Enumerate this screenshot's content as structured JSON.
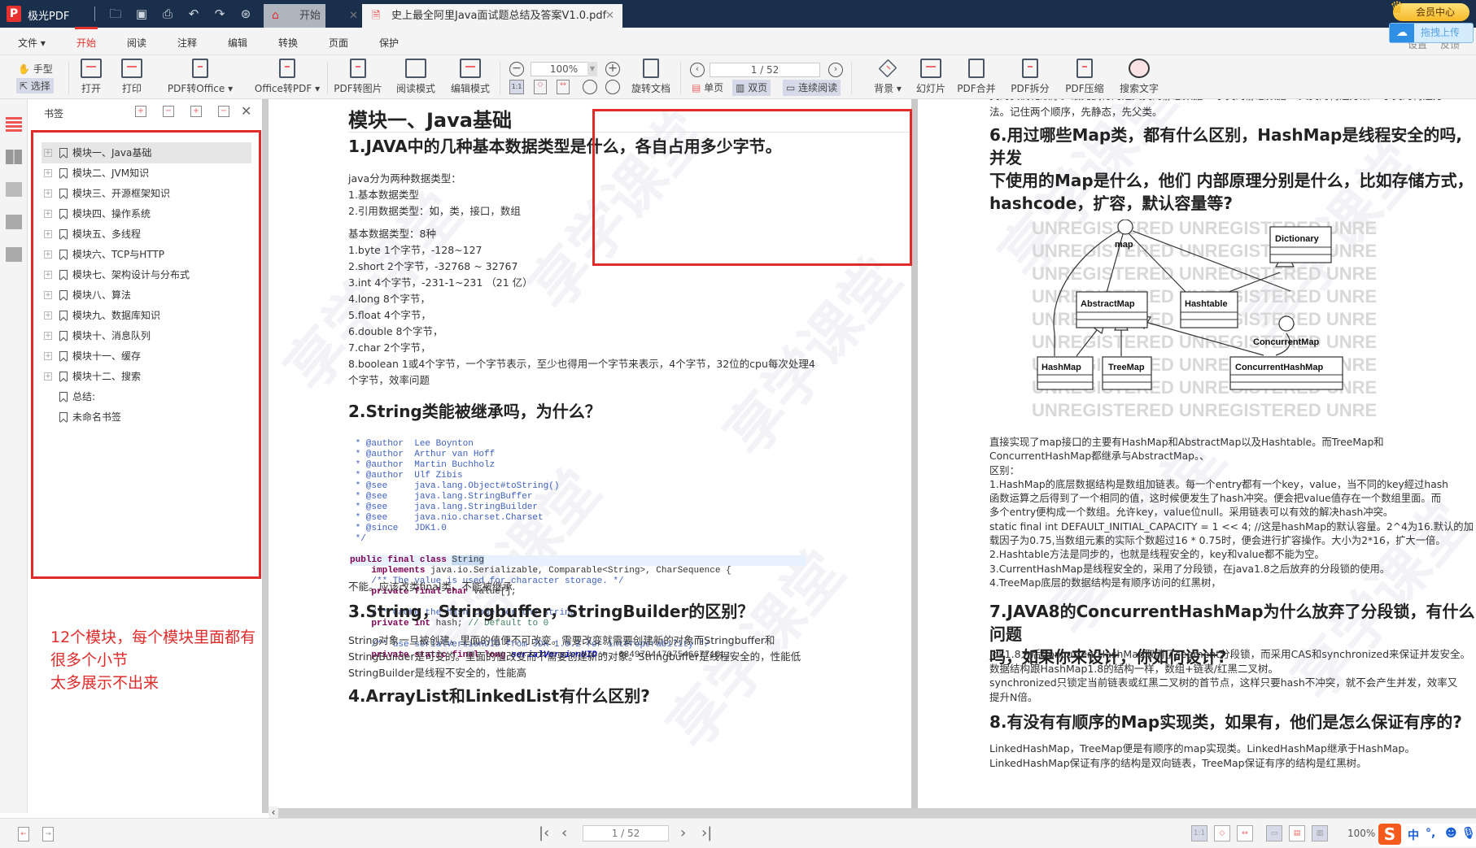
{
  "app": {
    "name": "极光PDF",
    "logo": "P"
  },
  "tabs": [
    {
      "label": "开始",
      "icon": "home-icon",
      "active": false
    },
    {
      "label": "史上最全阿里Java面试题总结及答案V1.0.pdf",
      "icon": "pdf-file-icon",
      "active": true
    }
  ],
  "vip": {
    "label": "会员中心"
  },
  "upload": {
    "label": "拖拽上传"
  },
  "menu": [
    {
      "label": "文件 ▾"
    },
    {
      "label": "开始",
      "active": true
    },
    {
      "label": "阅读"
    },
    {
      "label": "注释"
    },
    {
      "label": "编辑"
    },
    {
      "label": "转换"
    },
    {
      "label": "页面"
    },
    {
      "label": "保护"
    }
  ],
  "menu_right": {
    "settings": "设置",
    "feedback": "反馈"
  },
  "toolbar": {
    "hand": "手型",
    "select": "选择",
    "open": "打开",
    "print": "打印",
    "pdf_to_office": "PDF转Office ▾",
    "office_to_pdf": "Office转PDF ▾",
    "pdf_to_image": "PDF转图片",
    "read_mode": "阅读模式",
    "edit_mode": "编辑模式",
    "zoom": "100%",
    "rotate": "旋转文档",
    "page": "1 / 52",
    "single": "单页",
    "double": "双页",
    "continuous": "连续阅读",
    "background": "背景 ▾",
    "slideshow": "幻灯片",
    "merge": "PDF合并",
    "split": "PDF拆分",
    "compress": "PDF压缩",
    "search": "搜索文字"
  },
  "panel": {
    "title": "书签",
    "bookmarks": [
      {
        "label": "模块一、Java基础",
        "expandable": true,
        "selected": true
      },
      {
        "label": "模块二、JVM知识",
        "expandable": true
      },
      {
        "label": "模块三、开源框架知识",
        "expandable": true
      },
      {
        "label": "模块四、操作系统",
        "expandable": true
      },
      {
        "label": "模块五、多线程",
        "expandable": true
      },
      {
        "label": "模块六、TCP与HTTP",
        "expandable": true
      },
      {
        "label": "模块七、架构设计与分布式",
        "expandable": true
      },
      {
        "label": "模块八、算法",
        "expandable": true
      },
      {
        "label": "模块九、数据库知识",
        "expandable": true
      },
      {
        "label": "模块十、消息队列",
        "expandable": true
      },
      {
        "label": "模块十一、缓存",
        "expandable": true
      },
      {
        "label": "模块十二、搜索",
        "expandable": true
      },
      {
        "label": "总结:",
        "expandable": false
      },
      {
        "label": "未命名书签",
        "expandable": false
      }
    ],
    "annotation_line1": "12个模块，每个模块里面都有很多个小节",
    "annotation_line2": "太多展示不出来"
  },
  "left_page": {
    "module_title": "模块一、Java基础",
    "q1": "1.JAVA中的几种基本数据类型是什么，各自占用多少字节。",
    "q1_lines": [
      "java分为两种数据类型：",
      "1.基本数据类型",
      "2.引用数据类型：如，类，接口，数组"
    ],
    "q1_types": [
      "基本数据类型：8种",
      "1.byte 1个字节，-128~127",
      "2.short 2个字节，-32768 ~ 32767",
      "3.int 4个字节，-231-1~231  （21 亿）",
      "4.long 8个字节，",
      "5.float 4个字节，",
      "6.double 8个字节，",
      "7.char 2个字节，",
      "8.boolean 1或4个字节，一个字节表示，至少也得用一个字节来表示，4个字节，32位的cpu每次处理4",
      "个字节，效率问题"
    ],
    "q2": "2.String类能被继承吗，为什么？",
    "code_comment": [
      " * @author  Lee Boynton",
      " * @author  Arthur van Hoff",
      " * @author  Martin Buchholz",
      " * @author  Ulf Zibis",
      " * @see     java.lang.Object#toString()",
      " * @see     java.lang.StringBuffer",
      " * @see     java.lang.StringBuilder",
      " * @see     java.nio.charset.Charset",
      " * @since   JDK1.0",
      " */"
    ],
    "code": {
      "l1_kw": "public final class ",
      "l1_name": "String",
      "l2_kw": "    implements",
      "l2_rest": " java.io.Serializable, Comparable<String>, CharSequence {",
      "l3": "    /** The value is used for character storage. */",
      "l4_kw": "    private final char",
      "l4_rest": " value[];",
      "l5": "    /** Cache the hash code for the string */",
      "l6_kw": "    private int",
      "l6_rest": " hash; ",
      "l6_cm": "// Default to 0",
      "l7": "    /** use serialVersionUID from JDK 1.0.2 for interoperability */",
      "l8_kw": "    private static final long ",
      "l8_iv": "serialVersionUID",
      "l8_rest": " = -6849794470754667710L;"
    },
    "q2_answer": "不能。应该改类final类，不能被继承",
    "q3": "3.String，Stringbuffer，StringBuilder的区别？",
    "q3_lines": [
      "String对象一旦被创建，里面的值便不可改变。需要改变就需要创建新的对象而Stringbuffer和",
      "StringBuilder是可变的。里面的值改变而不需要创建新的对象。Stringbuffer是线程安全的，性能低",
      "StringBuilder是线程不安全的，性能高"
    ],
    "q4": "4.ArrayList和LinkedList有什么区别?"
  },
  "right_page": {
    "intro_lines": [
      "类的实例化顺序。最先执行的是父类的静态数据->子类的静态数据->父类的构造方法->子类的构造方",
      "法。记住两个顺序，先静态，先父类。"
    ],
    "q6_lines": [
      "6.用过哪些Map类，都有什么区别，HashMap是线程安全的吗,并发",
      "下使用的Map是什么，他们 内部原理分别是什么，比如存储方式，",
      "hashcode，扩容，默认容量等?"
    ],
    "diagram": {
      "watermark": "UNREGISTERED UNREGISTERED UNRE",
      "map": "map",
      "dictionary": "Dictionary",
      "abstract_map": "AbstractMap",
      "hashtable": "Hashtable",
      "concurrent_map": "ConcurrentMap",
      "hash_map": "HashMap",
      "tree_map": "TreeMap",
      "concurrent_hash_map": "ConcurrentHashMap"
    },
    "q6_answer": [
      "直接实现了map接口的主要有HashMap和AbstractMap以及Hashtable。而TreeMap和",
      "ConcurrentHashMap都继承与AbstractMap。、",
      "区别：",
      "1.HashMap的底层数据结构是数组加链表。每一个entry都有一个key，value，当不同的key經过hash",
      "函数运算之后得到了一个相同的值，这时候便发生了hash冲突。便会把value值存在一个数组里面。而",
      "多个entry便构成一个数组。允许key，value位null。采用链表可以有效的解决hash冲突。",
      "static final int DEFAULT_INITIAL_CAPACITY = 1 << 4; //这是hashMap的默认容量。2^4为16.默认的加",
      "载因子为0.75,当数组元素的实际个数超过16 * 0.75时，便会进行扩容操作。大小为2*16，扩大一倍。",
      "2.Hashtable方法是同步的，也就是线程安全的，key和value都不能为空。",
      "3.CurrentHashMap是线程安全的，采用了分段锁，在java1.8之后放弃的分段锁的使用。",
      "4.TreeMap底层的数据结构是有顺序访问的红黑树，"
    ],
    "q7_lines": [
      "7.JAVA8的ConcurrentHashMap为什么放弃了分段锁，有什么问题",
      "吗，如果你来设计，你如何设计?"
    ],
    "q7_answer": [
      "jdk1.8之后ConcurrentHashMap取消了segment分段锁，而采用CAS和synchronized来保证并发安全。",
      "数据结构跟HashMap1.8的结构一样，数组+链表/红黑二叉树。",
      "synchronized只锁定当前链表或红黑二叉树的首节点，这样只要hash不冲突，就不会产生并发，效率又",
      "提升N倍。"
    ],
    "q8": "8.有没有有顺序的Map实现类，如果有，他们是怎么保证有序的?",
    "q8_answer": [
      "LinkedHashMap，TreeMap便是有顺序的map实现类。LinkedHashMap继承于HashMap。",
      "LinkedHashMap保证有序的结构是双向链表，TreeMap保证有序的结构是红黑树。"
    ]
  },
  "watermark": "享学课堂",
  "statusbar": {
    "page": "1 / 52",
    "zoom": "100%",
    "ime": {
      "lang": "中",
      "punct": "°,"
    }
  }
}
